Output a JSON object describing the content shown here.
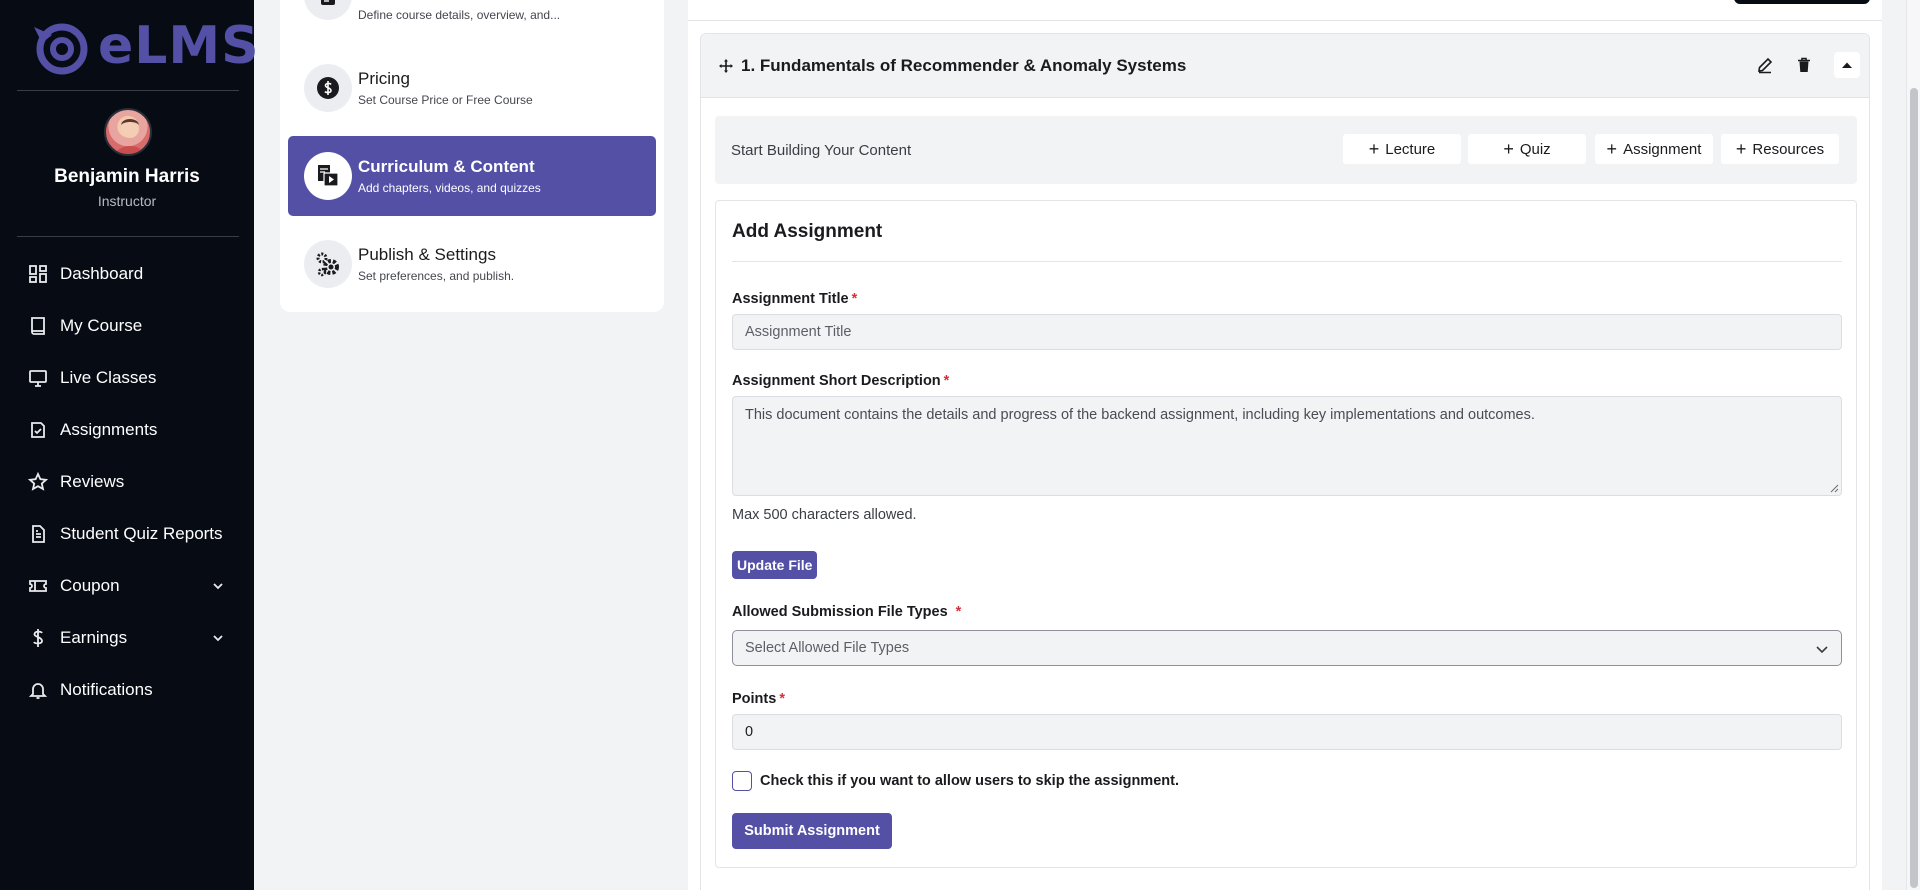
{
  "app": {
    "brand": "eLMS"
  },
  "user": {
    "name": "Benjamin Harris",
    "role": "Instructor"
  },
  "sidebar": {
    "items": [
      {
        "label": "Dashboard",
        "icon": "dashboard-icon"
      },
      {
        "label": "My Course",
        "icon": "book-icon"
      },
      {
        "label": "Live Classes",
        "icon": "monitor-icon"
      },
      {
        "label": "Assignments",
        "icon": "assignment-icon"
      },
      {
        "label": "Reviews",
        "icon": "star-icon"
      },
      {
        "label": "Student Quiz Reports",
        "icon": "report-icon"
      },
      {
        "label": "Coupon",
        "icon": "ticket-icon",
        "expandable": true
      },
      {
        "label": "Earnings",
        "icon": "dollar-icon",
        "expandable": true
      },
      {
        "label": "Notifications",
        "icon": "bell-icon"
      }
    ]
  },
  "steps": [
    {
      "title": "",
      "subtitle": "Define course details, overview, and...",
      "icon": "document-icon",
      "active": false
    },
    {
      "title": "Pricing",
      "subtitle": "Set Course Price or Free Course",
      "icon": "dollar-circle-icon",
      "active": false
    },
    {
      "title": "Curriculum & Content",
      "subtitle": "Add chapters, videos, and quizzes",
      "icon": "curriculum-icon",
      "active": true
    },
    {
      "title": "Publish & Settings",
      "subtitle": "Set preferences, and publish.",
      "icon": "gears-icon",
      "active": false
    }
  ],
  "chapter": {
    "title": "1. Fundamentals of Recommender & Anomaly Systems",
    "builder_label": "Start Building Your Content",
    "add_buttons": [
      "Lecture",
      "Quiz",
      "Assignment",
      "Resources"
    ]
  },
  "form": {
    "heading": "Add Assignment",
    "title_label": "Assignment Title",
    "title_placeholder": "Assignment Title",
    "desc_label": "Assignment Short Description",
    "desc_value": "This document contains the details and progress of the backend assignment, including key implementations and outcomes.",
    "desc_hint": "Max 500 characters allowed.",
    "file_button": "Update File",
    "file_types_label": "Allowed Submission File Types",
    "file_types_placeholder": "Select Allowed File Types",
    "points_label": "Points",
    "points_value": "0",
    "skip_checkbox_label": "Check this if you want to allow users to skip the assignment.",
    "skip_checked": false,
    "submit_label": "Submit Assignment",
    "required_mark": "*"
  },
  "colors": {
    "accent": "#5350a6",
    "sidebar_bg": "#070b14",
    "required": "#d92d3a"
  }
}
